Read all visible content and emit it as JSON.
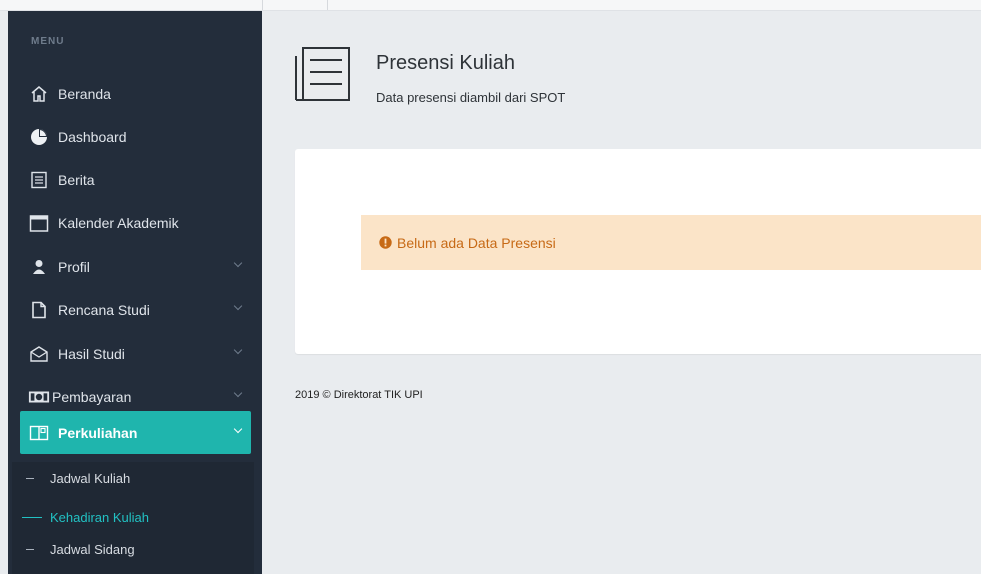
{
  "sidebar": {
    "menu_header": "MENU",
    "items": [
      {
        "label": "Beranda",
        "icon": "home-icon"
      },
      {
        "label": "Dashboard",
        "icon": "pie-chart-icon"
      },
      {
        "label": "Berita",
        "icon": "newspaper-icon"
      },
      {
        "label": "Kalender Akademik",
        "icon": "calendar-icon"
      },
      {
        "label": "Profil",
        "icon": "user-icon",
        "has_submenu": true
      },
      {
        "label": "Rencana Studi",
        "icon": "file-icon",
        "has_submenu": true
      },
      {
        "label": "Hasil Studi",
        "icon": "envelope-open-icon",
        "has_submenu": true
      },
      {
        "label": "Pembayaran",
        "icon": "money-icon",
        "has_submenu": true
      },
      {
        "label": "Perkuliahan",
        "icon": "book-icon",
        "has_submenu": true,
        "active": true
      }
    ],
    "subitems": [
      {
        "label": "Jadwal Kuliah"
      },
      {
        "label": "Kehadiran Kuliah",
        "current": true
      },
      {
        "label": "Jadwal Sidang"
      }
    ]
  },
  "header": {
    "title": "Presensi Kuliah",
    "subtitle": "Data presensi diambil dari SPOT",
    "icon": "list-document-icon"
  },
  "alert": {
    "text": "Belum ada Data Presensi",
    "icon": "exclamation-circle-icon"
  },
  "footer": {
    "text": "2019 © Direktorat TIK UPI"
  },
  "colors": {
    "sidebar_bg": "#232d3b",
    "accent": "#1fb5ad",
    "active_sub": "#22c1c3",
    "alert_bg": "#fbe4c8",
    "alert_text": "#c76a16",
    "main_bg": "#e9ecef"
  }
}
